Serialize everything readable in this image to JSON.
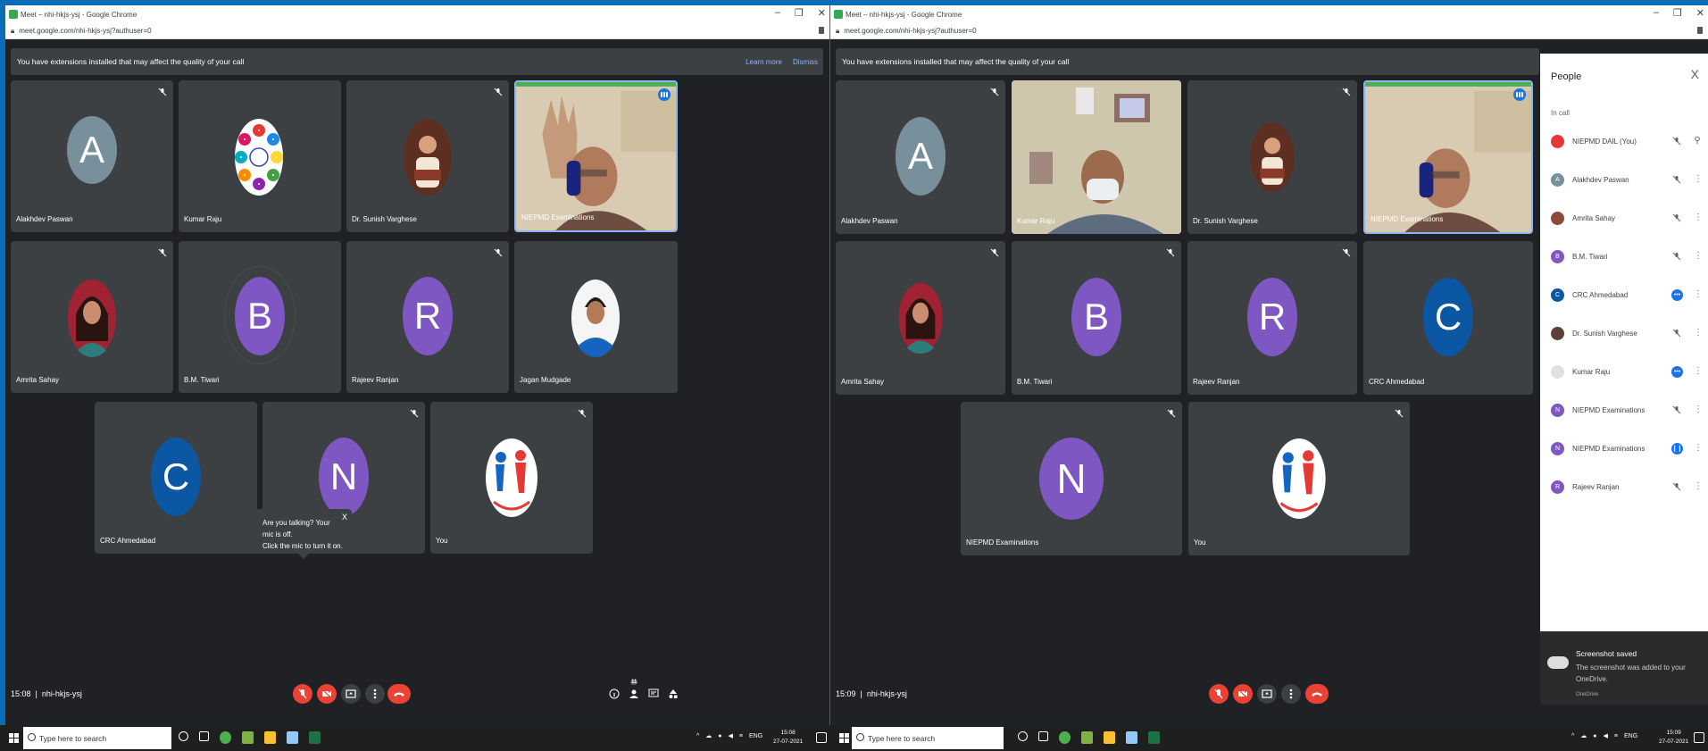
{
  "left": {
    "window_title": "Meet – nhi-hkjs-ysj - Google Chrome",
    "url": "meet.google.com/nhi-hkjs-ysj?authuser=0",
    "banner": {
      "text": "You have extensions installed that may affect the quality of your call",
      "learn_more": "Learn more",
      "dismiss": "Dismiss"
    },
    "tiles": [
      {
        "name": "Alakhdev Paswan",
        "initial": "A",
        "color": "#78909c"
      },
      {
        "name": "Kumar Raju"
      },
      {
        "name": "Dr. Sunish Varghese"
      },
      {
        "name": "NIEPMD Examinations"
      },
      {
        "name": "Amrita Sahay"
      },
      {
        "name": "B.M. Tiwari",
        "initial": "B",
        "color": "#7e57c2"
      },
      {
        "name": "Rajeev Ranjan",
        "initial": "R",
        "color": "#7e57c2"
      },
      {
        "name": "Jagan Mudgade"
      },
      {
        "name": "CRC Ahmedabad",
        "initial": "C",
        "color": "#0b57a4"
      },
      {
        "name": "N",
        "initial": "N",
        "color": "#7e57c2"
      },
      {
        "name": "You"
      }
    ],
    "tooltip": {
      "line1": "Are you talking? Your mic is off.",
      "line2": "Click the mic to turn it on.",
      "close": "X"
    },
    "time": "15:08",
    "meeting_code": "nhi-hkjs-ysj",
    "people_count": "11",
    "taskbar": {
      "search": "Type here to search",
      "lang": "ENG",
      "time": "15:08",
      "date": "27-07-2021"
    }
  },
  "right": {
    "window_title": "Meet – nhi-hkjs-ysj - Google Chrome",
    "url": "meet.google.com/nhi-hkjs-ysj?authuser=0",
    "banner": {
      "text": "You have extensions installed that may affect the quality of your call"
    },
    "tiles": [
      {
        "name": "Alakhdev Paswan",
        "initial": "A",
        "color": "#78909c"
      },
      {
        "name": "Kumar Raju"
      },
      {
        "name": "Dr. Sunish Varghese"
      },
      {
        "name": "NIEPMD Examinations"
      },
      {
        "name": "Amrita Sahay"
      },
      {
        "name": "B.M. Tiwari",
        "initial": "B",
        "color": "#7e57c2"
      },
      {
        "name": "Rajeev Ranjan",
        "initial": "R",
        "color": "#7e57c2"
      },
      {
        "name": "CRC Ahmedabad",
        "initial": "C",
        "color": "#0b57a4"
      },
      {
        "name": "NIEPMD Examinations",
        "initial": "N",
        "color": "#7e57c2"
      },
      {
        "name": "You"
      }
    ],
    "time": "15:09",
    "meeting_code": "nhi-hkjs-ysj",
    "people": {
      "title": "People",
      "close": "X",
      "section": "In call",
      "list": [
        {
          "name": "NIEPMD DAIL (You)",
          "initial": "",
          "color": "#e53935"
        },
        {
          "name": "Alakhdev Paswan",
          "initial": "A",
          "color": "#78909c"
        },
        {
          "name": "Amrita Sahay",
          "initial": "",
          "color": "#8d4a3a"
        },
        {
          "name": "B.M. Tiwari",
          "initial": "B",
          "color": "#7e57c2"
        },
        {
          "name": "CRC Ahmedabad",
          "initial": "C",
          "color": "#0b57a4"
        },
        {
          "name": "Dr. Sunish Varghese",
          "initial": "",
          "color": "#5d4037"
        },
        {
          "name": "Kumar Raju",
          "initial": "",
          "color": "#e0e0e0"
        },
        {
          "name": "NIEPMD Examinations",
          "initial": "N",
          "color": "#7e57c2"
        },
        {
          "name": "NIEPMD Examinations",
          "initial": "N",
          "color": "#7e57c2"
        },
        {
          "name": "Rajeev Ranjan",
          "initial": "R",
          "color": "#7e57c2"
        }
      ]
    },
    "toast": {
      "title": "Screenshot saved",
      "body": "The screenshot was added to your OneDrive.",
      "source": "OneDrive"
    },
    "taskbar": {
      "search": "Type here to search",
      "lang": "ENG",
      "time": "15:09",
      "date": "27-07-2021"
    }
  }
}
